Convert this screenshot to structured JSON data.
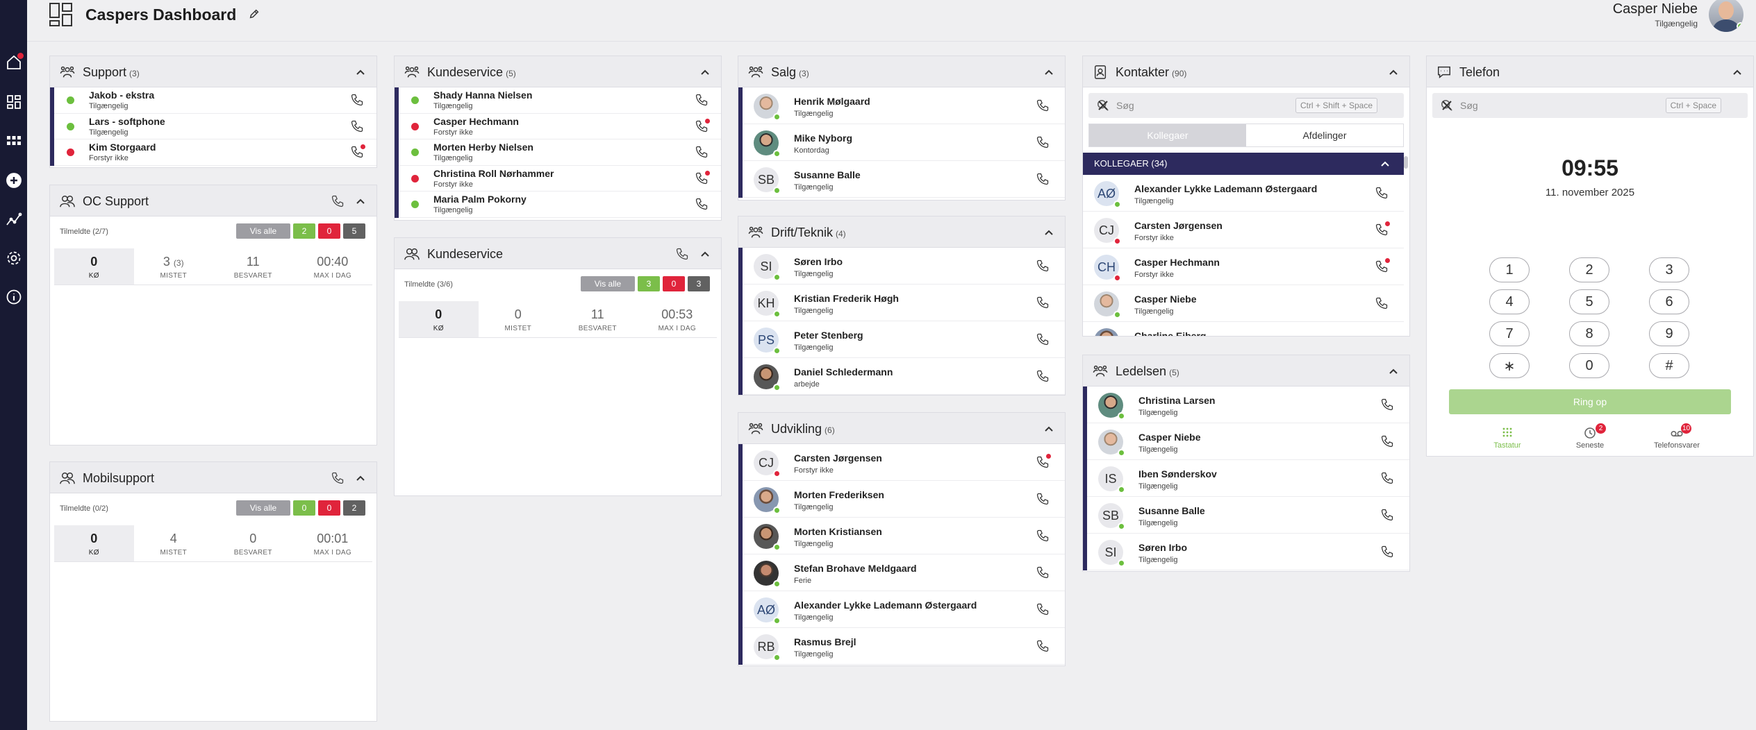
{
  "colors": {
    "nav": "#181a33",
    "accent": "#2d2a5e",
    "available": "#6cbf3e",
    "busy": "#e0243b",
    "gray": "#9d9da2",
    "dark": "#616161"
  },
  "header": {
    "title": "Caspers Dashboard",
    "user_name": "Casper Niebe",
    "user_status": "Tilgængelig"
  },
  "nav": [
    "home-icon",
    "dashboard-icon",
    "apps-grid-icon",
    "add-icon",
    "stats-icon",
    "settings-icon",
    "info-icon"
  ],
  "support": {
    "title": "Support",
    "count": "(3)",
    "rows": [
      {
        "name": "Jakob - ekstra",
        "status": "Tilgængelig",
        "state": "green"
      },
      {
        "name": "Lars - softphone",
        "status": "Tilgængelig",
        "state": "green"
      },
      {
        "name": "Kim Storgaard",
        "status": "Forstyr ikke",
        "state": "red"
      }
    ]
  },
  "kundeservice_users": {
    "title": "Kundeservice",
    "count": "(5)",
    "rows": [
      {
        "name": "Shady Hanna Nielsen",
        "status": "Tilgængelig",
        "state": "green"
      },
      {
        "name": "Casper Hechmann",
        "status": "Forstyr ikke",
        "state": "red"
      },
      {
        "name": "Morten Herby Nielsen",
        "status": "Tilgængelig",
        "state": "green"
      },
      {
        "name": "Christina Roll Nørhammer",
        "status": "Forstyr ikke",
        "state": "red"
      },
      {
        "name": "Maria Palm Pokorny",
        "status": "Tilgængelig",
        "state": "green"
      }
    ]
  },
  "oc_support": {
    "title": "OC Support",
    "logged_in": "Tilmeldte (2/7)",
    "show_all": "Vis alle",
    "b1": "2",
    "b2": "0",
    "b3": "5",
    "stats": [
      {
        "v": "0",
        "sub": "",
        "l": "KØ"
      },
      {
        "v": "3",
        "sub": "(3)",
        "l": "MISTET"
      },
      {
        "v": "11",
        "sub": "",
        "l": "BESVARET"
      },
      {
        "v": "00:40",
        "sub": "",
        "l": "MAX I DAG"
      }
    ]
  },
  "kundeservice_queue": {
    "title": "Kundeservice",
    "logged_in": "Tilmeldte (3/6)",
    "show_all": "Vis alle",
    "b1": "3",
    "b2": "0",
    "b3": "3",
    "stats": [
      {
        "v": "0",
        "sub": "",
        "l": "KØ"
      },
      {
        "v": "0",
        "sub": "",
        "l": "MISTET"
      },
      {
        "v": "11",
        "sub": "",
        "l": "BESVARET"
      },
      {
        "v": "00:53",
        "sub": "",
        "l": "MAX I DAG"
      }
    ]
  },
  "mobilsupport": {
    "title": "Mobilsupport",
    "logged_in": "Tilmeldte (0/2)",
    "show_all": "Vis alle",
    "b1": "0",
    "b2": "0",
    "b3": "2",
    "stats": [
      {
        "v": "0",
        "sub": "",
        "l": "KØ"
      },
      {
        "v": "4",
        "sub": "",
        "l": "MISTET"
      },
      {
        "v": "0",
        "sub": "",
        "l": "BESVARET"
      },
      {
        "v": "00:01",
        "sub": "",
        "l": "MAX I DAG"
      }
    ]
  },
  "salg": {
    "title": "Salg",
    "count": "(3)",
    "rows": [
      {
        "name": "Henrik Mølgaard",
        "status": "Tilgængelig",
        "state": "green",
        "initials": "",
        "photo": "ph3"
      },
      {
        "name": "Mike Nyborg",
        "status": "Kontordag",
        "state": "green",
        "initials": "",
        "photo": "ph2"
      },
      {
        "name": "Susanne Balle",
        "status": "Tilgængelig",
        "state": "green",
        "initials": "SB",
        "photo": ""
      }
    ]
  },
  "drift": {
    "title": "Drift/Teknik",
    "count": "(4)",
    "rows": [
      {
        "name": "Søren Irbo",
        "status": "Tilgængelig",
        "state": "green",
        "initials": "SI",
        "photo": ""
      },
      {
        "name": "Kristian Frederik Høgh",
        "status": "Tilgængelig",
        "state": "green",
        "initials": "KH",
        "photo": ""
      },
      {
        "name": "Peter Stenberg",
        "status": "Tilgængelig",
        "state": "green",
        "initials": "PS",
        "photo": "blu"
      },
      {
        "name": "Daniel Schledermann",
        "status": "arbejde",
        "state": "green",
        "initials": "",
        "photo": "ph4"
      }
    ]
  },
  "udvikling": {
    "title": "Udvikling",
    "count": "(6)",
    "rows": [
      {
        "name": "Carsten Jørgensen",
        "status": "Forstyr ikke",
        "state": "red",
        "initials": "CJ",
        "photo": ""
      },
      {
        "name": "Morten Frederiksen",
        "status": "Tilgængelig",
        "state": "green",
        "initials": "",
        "photo": "ph1"
      },
      {
        "name": "Morten Kristiansen",
        "status": "Tilgængelig",
        "state": "green",
        "initials": "",
        "photo": "ph4"
      },
      {
        "name": "Stefan Brohave Meldgaard",
        "status": "Ferie",
        "state": "green",
        "initials": "",
        "photo": "ph5"
      },
      {
        "name": "Alexander Lykke Lademann Østergaard",
        "status": "Tilgængelig",
        "state": "green",
        "initials": "AØ",
        "photo": "blu"
      },
      {
        "name": "Rasmus Brejl",
        "status": "Tilgængelig",
        "state": "green",
        "initials": "RB",
        "photo": ""
      }
    ]
  },
  "kontakter": {
    "title": "Kontakter",
    "count": "(90)",
    "search_placeholder": "Søg",
    "shortcut": "Ctrl + Shift + Space",
    "tab_colleagues": "Kollegaer",
    "tab_departments": "Afdelinger",
    "section": "KOLLEGAER (34)",
    "rows": [
      {
        "name": "Alexander Lykke Lademann Østergaard",
        "status": "Tilgængelig",
        "state": "green",
        "initials": "AØ",
        "photo": "blu"
      },
      {
        "name": "Carsten Jørgensen",
        "status": "Forstyr ikke",
        "state": "red",
        "initials": "CJ",
        "photo": ""
      },
      {
        "name": "Casper Hechmann",
        "status": "Forstyr ikke",
        "state": "red",
        "initials": "CH",
        "photo": "blu"
      },
      {
        "name": "Casper Niebe",
        "status": "Tilgængelig",
        "state": "green",
        "initials": "",
        "photo": "ph3"
      },
      {
        "name": "Charline Eiberg",
        "status": "",
        "state": "",
        "initials": "",
        "photo": "ph1"
      }
    ]
  },
  "ledelsen": {
    "title": "Ledelsen",
    "count": "(5)",
    "rows": [
      {
        "name": "Christina Larsen",
        "status": "Tilgængelig",
        "state": "green",
        "initials": "",
        "photo": "ph2"
      },
      {
        "name": "Casper Niebe",
        "status": "Tilgængelig",
        "state": "green",
        "initials": "",
        "photo": "ph3"
      },
      {
        "name": "Iben Sønderskov",
        "status": "Tilgængelig",
        "state": "green",
        "initials": "IS",
        "photo": ""
      },
      {
        "name": "Susanne Balle",
        "status": "Tilgængelig",
        "state": "green",
        "initials": "SB",
        "photo": ""
      },
      {
        "name": "Søren Irbo",
        "status": "Tilgængelig",
        "state": "green",
        "initials": "SI",
        "photo": ""
      }
    ]
  },
  "telefon": {
    "title": "Telefon",
    "search_placeholder": "Søg",
    "shortcut": "Ctrl + Space",
    "time": "09:55",
    "date": "11. november 2025",
    "keys": [
      "1",
      "2",
      "3",
      "4",
      "5",
      "6",
      "7",
      "8",
      "9",
      "∗",
      "0",
      "#"
    ],
    "ring": "Ring op",
    "tabs": [
      {
        "label": "Tastatur",
        "badge": ""
      },
      {
        "label": "Seneste",
        "badge": "2"
      },
      {
        "label": "Telefonsvarer",
        "badge": "10"
      }
    ]
  }
}
